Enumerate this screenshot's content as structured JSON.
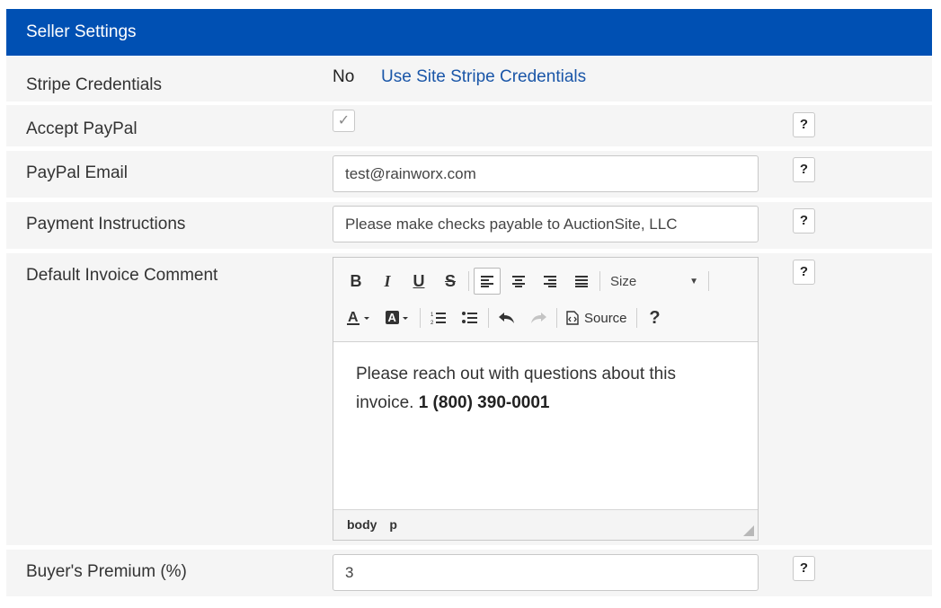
{
  "header": {
    "title": "Seller Settings"
  },
  "rows": {
    "stripe": {
      "label": "Stripe Credentials",
      "value": "No",
      "link": "Use Site Stripe Credentials"
    },
    "paypal": {
      "label": "Accept PayPal",
      "checked": true
    },
    "paypal_email": {
      "label": "PayPal Email",
      "value": "test@rainworx.com"
    },
    "payment_instructions": {
      "label": "Payment Instructions",
      "value": "Please make checks payable to AuctionSite, LLC"
    },
    "invoice_comment": {
      "label": "Default Invoice Comment",
      "text": "Please reach out with questions about this invoice.",
      "phone": "1 (800) 390-0001"
    },
    "buyers_premium": {
      "label": "Buyer's Premium (%)",
      "value": "3"
    }
  },
  "help_label": "?",
  "editor": {
    "toolbar": {
      "bold": "B",
      "italic": "I",
      "underline": "U",
      "strike": "S",
      "size_label": "Size",
      "source_label": "Source",
      "help": "?"
    },
    "status": {
      "path1": "body",
      "path2": "p"
    }
  },
  "colors": {
    "header_bg": "#0050b3",
    "link": "#1a56a8",
    "row_bg": "#f5f5f5"
  }
}
